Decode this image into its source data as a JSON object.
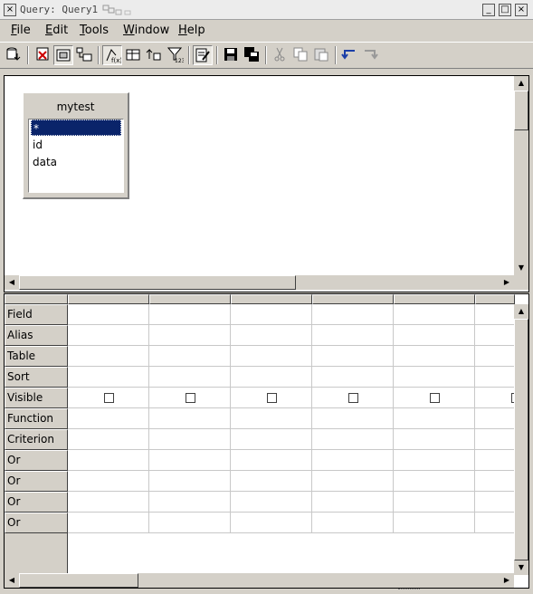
{
  "window": {
    "title": "Query: Query1",
    "buttons": {
      "minimize": "_",
      "maximize": "□",
      "close": "×"
    }
  },
  "menubar": {
    "items": [
      {
        "label": "File",
        "accel": "F",
        "rest": "ile"
      },
      {
        "label": "Edit",
        "accel": "E",
        "rest": "dit"
      },
      {
        "label": "Tools",
        "accel": "T",
        "rest": "ools"
      },
      {
        "label": "Window",
        "accel": "W",
        "rest": "indow"
      },
      {
        "label": "Help",
        "accel": "H",
        "rest": "elp"
      }
    ]
  },
  "toolbar": {
    "icons": [
      "run-query-icon",
      "delete-table-icon",
      "design-view-icon",
      "add-table-icon",
      "function-icon",
      "table-names-icon",
      "sort-icon",
      "distinct-icon",
      "edit-sql-icon",
      "save-icon",
      "save-all-icon",
      "cut-icon",
      "copy-icon",
      "paste-icon",
      "undo-icon",
      "redo-icon"
    ]
  },
  "table_window": {
    "name": "mytest",
    "fields": [
      "*",
      "id",
      "data"
    ],
    "selected_field": "*"
  },
  "grid": {
    "row_labels": [
      "Field",
      "Alias",
      "Table",
      "Sort",
      "Visible",
      "Function",
      "Criterion",
      "Or",
      "Or",
      "Or",
      "Or"
    ],
    "column_count": 6,
    "visible_checkboxes": [
      false,
      false,
      false,
      false,
      false,
      false
    ]
  },
  "colors": {
    "selection": "#0a246a",
    "face": "#d4d0c8"
  }
}
